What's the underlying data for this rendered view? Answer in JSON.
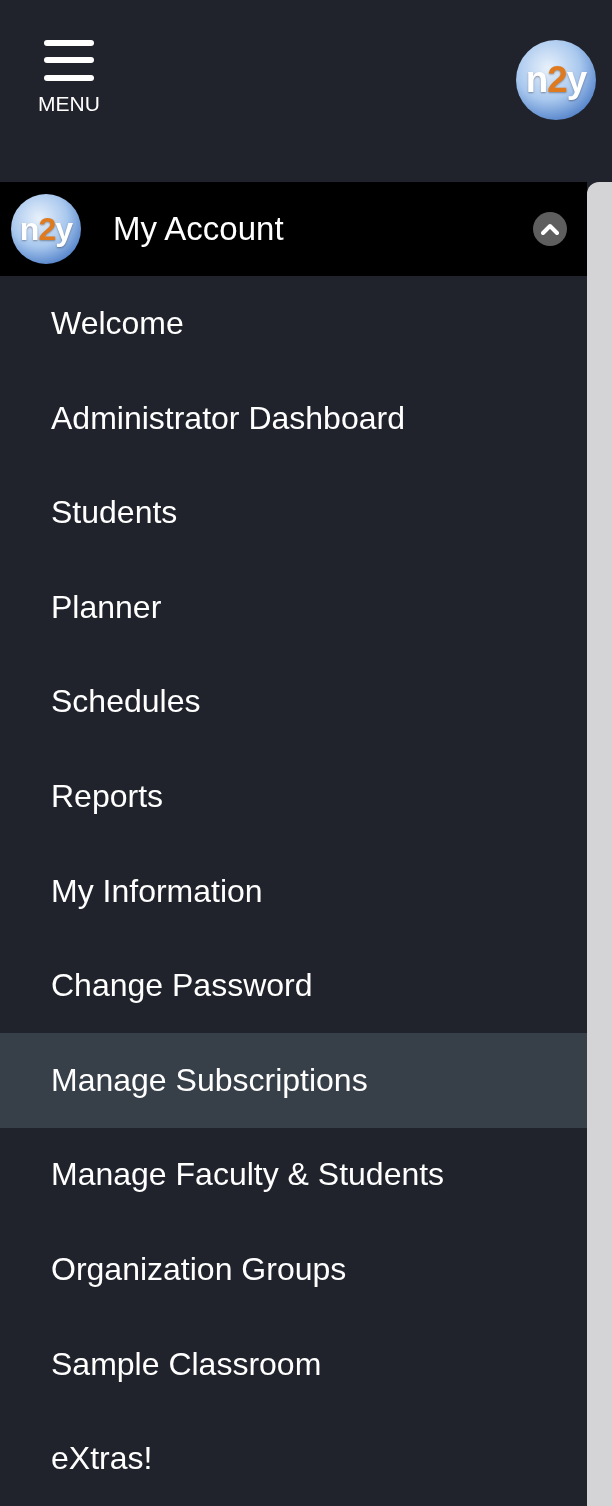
{
  "header": {
    "menu_label": "MENU",
    "logo": [
      {
        "text": "n",
        "accent": false
      },
      {
        "text": "2",
        "accent": true
      },
      {
        "text": "y",
        "accent": false
      }
    ]
  },
  "section": {
    "title": "My Account",
    "expanded": true,
    "logo": [
      {
        "text": "n",
        "accent": false
      },
      {
        "text": "2",
        "accent": true
      },
      {
        "text": "y",
        "accent": false
      }
    ]
  },
  "items": [
    {
      "label": "Welcome",
      "selected": false
    },
    {
      "label": "Administrator Dashboard",
      "selected": false
    },
    {
      "label": "Students",
      "selected": false
    },
    {
      "label": "Planner",
      "selected": false
    },
    {
      "label": "Schedules",
      "selected": false
    },
    {
      "label": "Reports",
      "selected": false
    },
    {
      "label": "My Information",
      "selected": false
    },
    {
      "label": "Change Password",
      "selected": false
    },
    {
      "label": "Manage Subscriptions",
      "selected": true
    },
    {
      "label": "Manage Faculty & Students",
      "selected": false
    },
    {
      "label": "Organization Groups",
      "selected": false
    },
    {
      "label": "Sample Classroom",
      "selected": false
    },
    {
      "label": "eXtras!",
      "selected": false
    }
  ]
}
